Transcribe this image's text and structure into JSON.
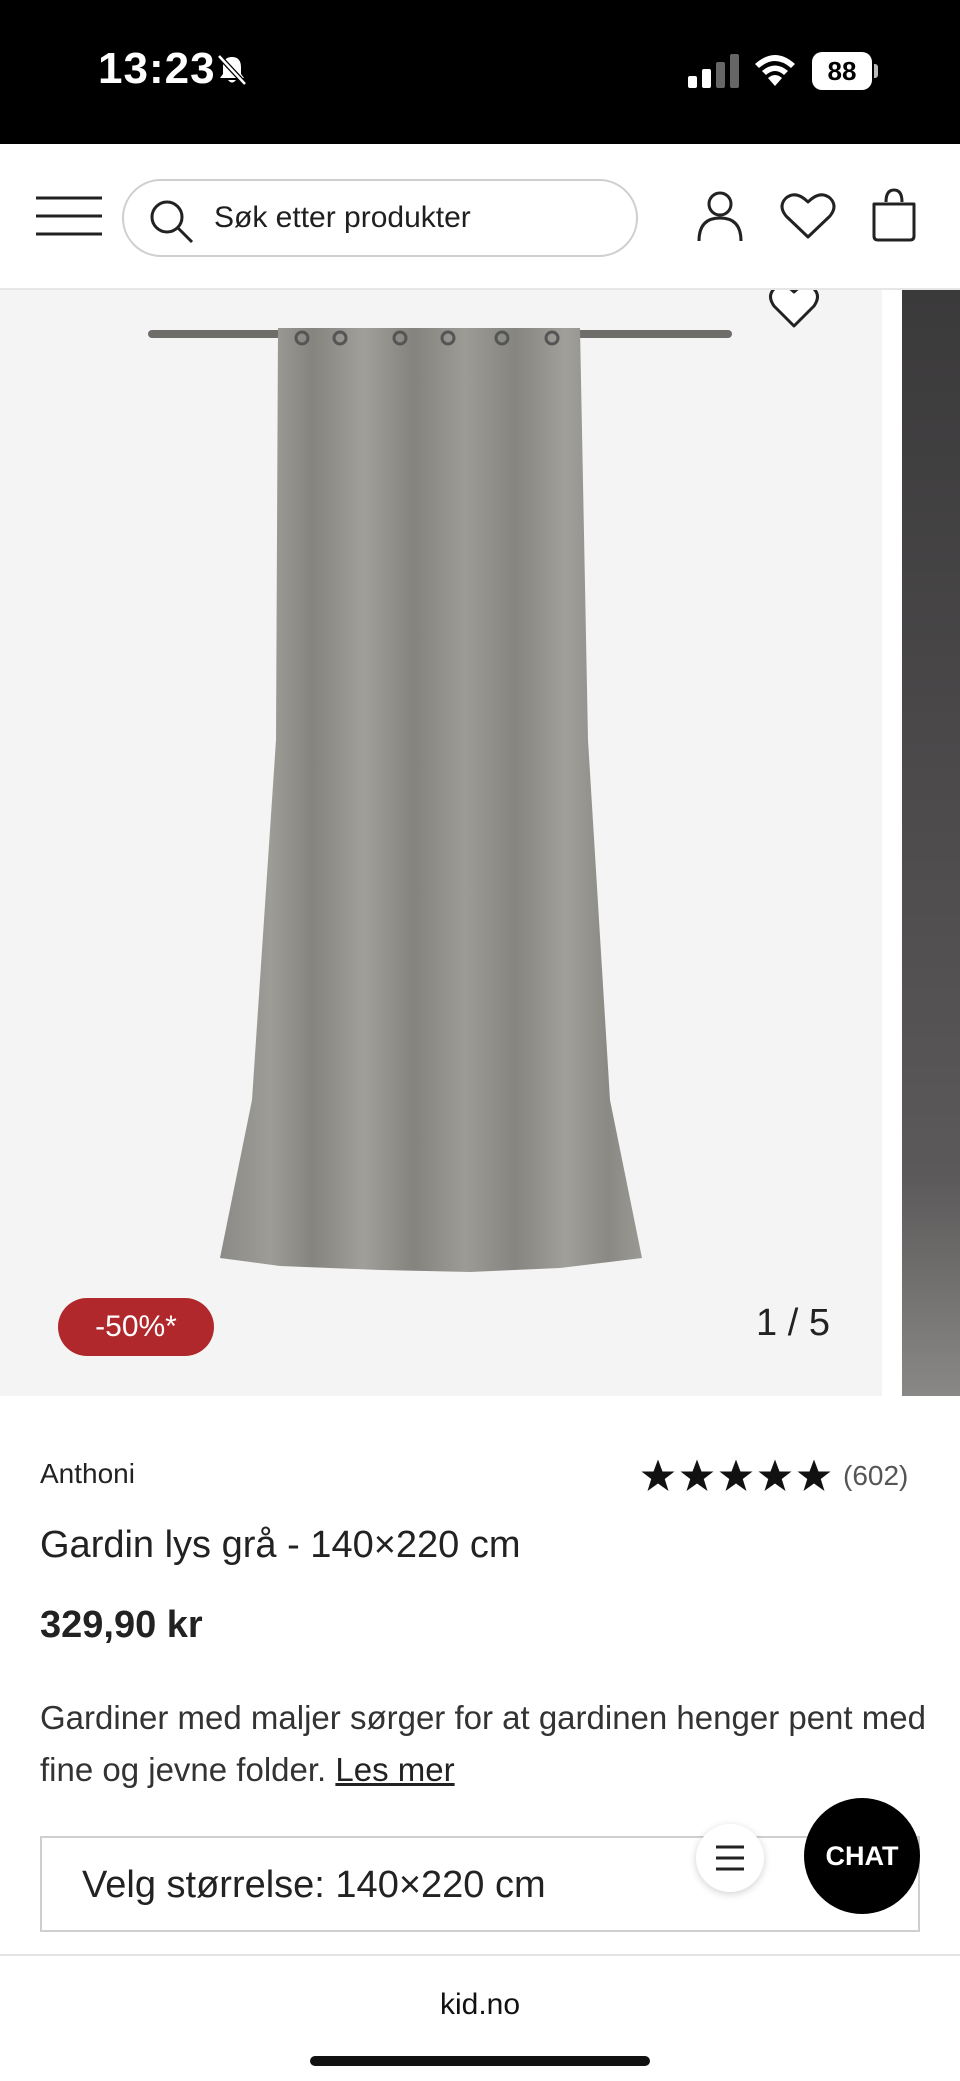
{
  "status_bar": {
    "time": "13:23",
    "battery": "88"
  },
  "header": {
    "search": {
      "placeholder": "Søk etter produkter"
    }
  },
  "gallery": {
    "discount_badge": "-50%*",
    "slide_counter": "1 / 5"
  },
  "product": {
    "brand": "Anthoni",
    "rating": {
      "stars": 5,
      "review_count": "(602)"
    },
    "title": "Gardin lys grå - 140×220 cm",
    "price": "329,90 kr",
    "description": "Gardiner med maljer sørger for at gardinen henger pent med fine og jevne folder.",
    "read_more": "Les mer",
    "size_select": "Velg størrelse: 140×220 cm"
  },
  "chat": {
    "label": "CHAT"
  },
  "browser": {
    "url": "kid.no"
  },
  "colors": {
    "discount": "#b0282c",
    "chat": "#000000"
  }
}
